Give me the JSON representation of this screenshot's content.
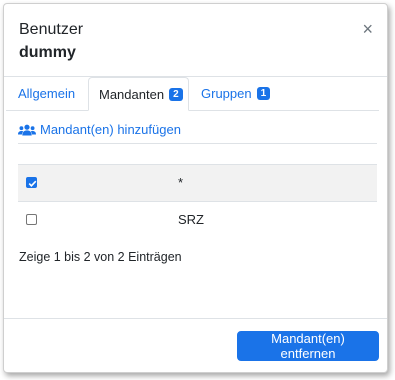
{
  "header": {
    "title": "Benutzer",
    "username": "dummy",
    "close_glyph": "×"
  },
  "tabs": [
    {
      "label": "Allgemein",
      "badge": null
    },
    {
      "label": "Mandanten",
      "badge": "2",
      "active": true
    },
    {
      "label": "Gruppen",
      "badge": "1"
    }
  ],
  "actions": {
    "add_label": "Mandant(en) hinzufügen",
    "add_icon": "users-icon",
    "remove_label": "Mandant(en) entfernen"
  },
  "table": {
    "rows": [
      {
        "checked": true,
        "name": "*"
      },
      {
        "checked": false,
        "name": "SRZ"
      }
    ],
    "info": "Zeige 1 bis 2 von 2 Einträgen"
  },
  "colors": {
    "accent": "#1a73e8",
    "row_alt": "#f2f2f2",
    "border": "#dee2e6"
  }
}
